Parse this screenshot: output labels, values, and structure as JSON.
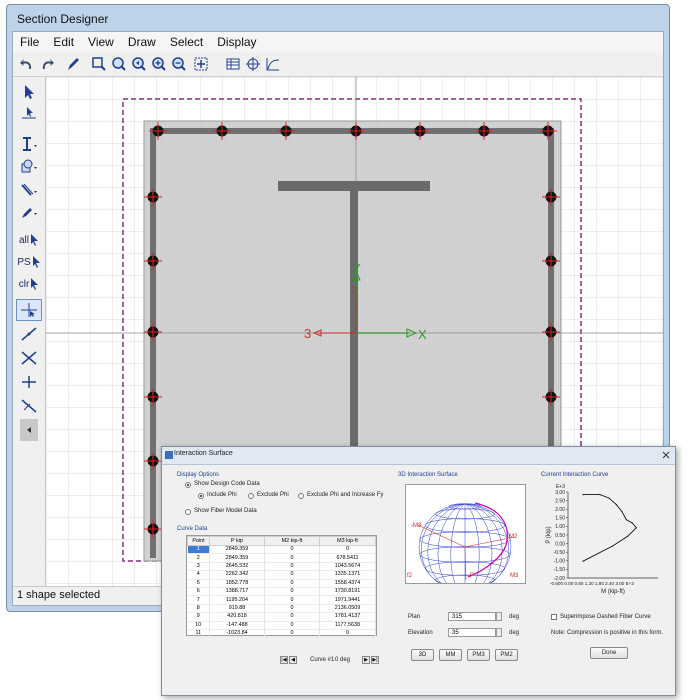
{
  "window": {
    "title": "Section Designer"
  },
  "menu": [
    "File",
    "Edit",
    "View",
    "Draw",
    "Select",
    "Display"
  ],
  "left_tools": {
    "all": "all",
    "ps": "PS",
    "clr": "clr"
  },
  "canvas": {
    "axis_y": "Y",
    "axis_x": "X",
    "axis_3": "3",
    "axis_2": "2"
  },
  "status": {
    "text": "1 shape selected"
  },
  "dialog": {
    "title": "Interaction Surface",
    "display_options": "Display Options",
    "show_design": "Show Design Code Data",
    "include_phi": "Include Phi",
    "exclude_phi": "Exclude Phi",
    "exclude_increase": "Exclude Phi and Increase Fy",
    "show_fiber": "Show Fiber Model Data",
    "curve_data": "Curve Data",
    "surface_title": "3D Interaction Surface",
    "curve_title": "Current Interaction Curve",
    "table": {
      "headers": [
        "Point",
        "P  kip",
        "M2  kip-ft",
        "M3  kip-ft"
      ],
      "rows": [
        [
          "1",
          "2849.359",
          "0",
          "0"
        ],
        [
          "2",
          "2849.359",
          "0",
          "678.5411"
        ],
        [
          "3",
          "2645.532",
          "0",
          "1043.5674"
        ],
        [
          "4",
          "2262.342",
          "0",
          "1335.1371"
        ],
        [
          "5",
          "1852.778",
          "0",
          "1558.4374"
        ],
        [
          "6",
          "1388.717",
          "0",
          "1730.8191"
        ],
        [
          "7",
          "1195.204",
          "0",
          "1971.9441"
        ],
        [
          "8",
          "919.88",
          "0",
          "2136.0509"
        ],
        [
          "9",
          "420.818",
          "0",
          "1781.4137"
        ],
        [
          "10",
          "-147.488",
          "0",
          "1177.5638"
        ],
        [
          "11",
          "-1023.84",
          "0",
          "0"
        ]
      ]
    },
    "curve_label": "Curve #1",
    "curve_deg": "0 deg",
    "plan_label": "Plan",
    "plan_value": "315",
    "elev_label": "Elevation",
    "elev_value": "35",
    "deg": "deg",
    "btn_3d": "3D",
    "btn_mm": "MM",
    "btn_pm3": "PM3",
    "btn_pm2": "PM2",
    "superimpose": "Superimpose Dashed Fiber Curve",
    "note": "Note:  Compression is positive in this form.",
    "done": "Done",
    "surface_labels": {
      "m3_left": "-M3",
      "m2_right": "M2",
      "p_bottom": "-P",
      "f2": "f2",
      "m3_bottom": "M3"
    },
    "chart": {
      "e3_top": "E+3",
      "ylabel": "P (kip)",
      "yticks": [
        "3.00",
        "2.50",
        "2.00",
        "1.50",
        "1.00",
        "0.50",
        "0.00",
        "-0.50",
        "-1.00",
        "-1.50",
        "-2.00"
      ],
      "xticks": "-0.600 0.00 0.60 1.20 1.80 2.40 3.00  E+3",
      "xlabel": "M (kip-ft)"
    }
  },
  "chart_data": {
    "type": "line",
    "title": "Current Interaction Curve",
    "xlabel": "M (kip-ft)",
    "ylabel": "P (kip)",
    "x": [
      0,
      678.5411,
      1043.5674,
      1335.1371,
      1558.4374,
      1730.8191,
      1971.9441,
      2136.0509,
      1781.4137,
      1177.5638,
      0
    ],
    "y": [
      2849.359,
      2849.359,
      2645.532,
      2262.342,
      1852.778,
      1388.717,
      1195.204,
      919.88,
      420.818,
      -147.488,
      -1023.84
    ],
    "xlim": [
      -600,
      3000
    ],
    "ylim": [
      -2000,
      3000
    ],
    "grid": false
  }
}
